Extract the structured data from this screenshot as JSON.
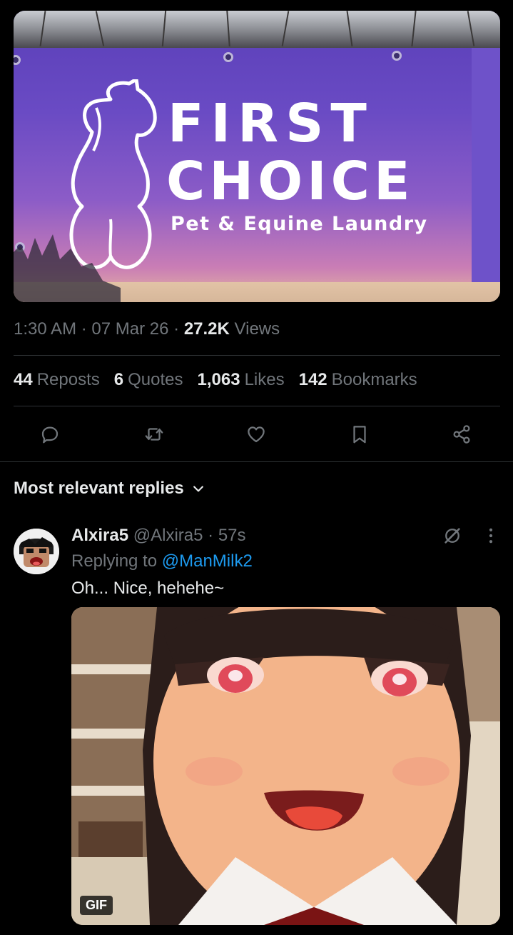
{
  "post": {
    "image": {
      "alt_icon": "sign-photo",
      "sign_line1": "FIRST",
      "sign_line2": "CHOICE",
      "sign_line3": "Pet & Equine Laundry"
    },
    "time": "1:30 AM",
    "date": "07 Mar 26",
    "separator": "·",
    "views_count": "27.2K",
    "views_label": "Views"
  },
  "stats": [
    {
      "count": "44",
      "label": "Reposts"
    },
    {
      "count": "6",
      "label": "Quotes"
    },
    {
      "count": "1,063",
      "label": "Likes"
    },
    {
      "count": "142",
      "label": "Bookmarks"
    }
  ],
  "actions": [
    {
      "name": "reply-icon"
    },
    {
      "name": "repost-icon"
    },
    {
      "name": "like-icon"
    },
    {
      "name": "bookmark-icon"
    },
    {
      "name": "share-icon"
    }
  ],
  "replies": {
    "sort_label": "Most relevant replies"
  },
  "reply": {
    "name": "Alxira5",
    "handle": "@Alxira5",
    "separator": "·",
    "age": "57s",
    "replying_prefix": "Replying to",
    "replying_mention": "@ManMilk2",
    "text": "Oh... Nice, hehehe~",
    "gif_badge": "GIF"
  },
  "colors": {
    "background": "#000000",
    "text_primary": "#e7e9ea",
    "text_secondary": "#71767b",
    "accent": "#1d9bf0",
    "divider": "#2f3336"
  }
}
